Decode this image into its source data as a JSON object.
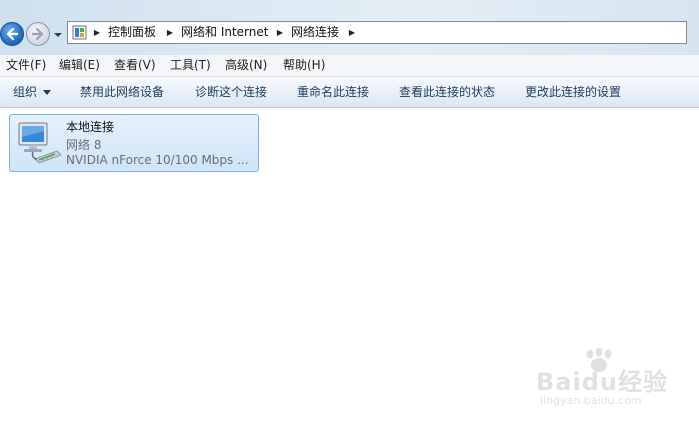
{
  "address_bar": {
    "breadcrumbs": [
      "控制面板",
      "网络和 Internet",
      "网络连接"
    ]
  },
  "menu": {
    "items": [
      "文件(F)",
      "编辑(E)",
      "查看(V)",
      "工具(T)",
      "高级(N)",
      "帮助(H)"
    ]
  },
  "commands": {
    "organize": "组织",
    "disable": "禁用此网络设备",
    "diagnose": "诊断这个连接",
    "rename": "重命名此连接",
    "status": "查看此连接的状态",
    "settings": "更改此连接的设置"
  },
  "connection": {
    "name": "本地连接",
    "network": "网络  8",
    "device": "NVIDIA nForce 10/100 Mbps ..."
  },
  "watermark": {
    "brand": "Baidu经验",
    "url": "jingyan.baidu.com"
  },
  "colors": {
    "selection_fill": "#cfe4f8",
    "selection_border": "#84acdd",
    "command_text": "#1e3a5f"
  }
}
